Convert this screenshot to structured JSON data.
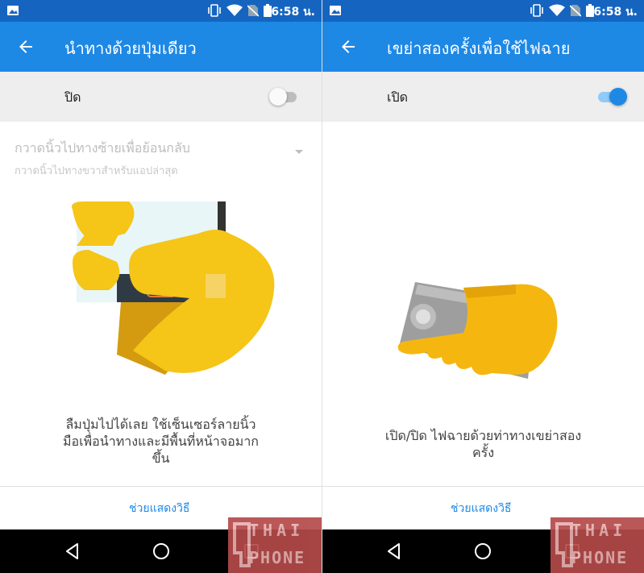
{
  "colors": {
    "status_bar": "#1565c0",
    "app_bar": "#1e88e5",
    "accent": "#1e88e5",
    "toggle_row_bg": "#eeeeee",
    "nav_bar": "#000000",
    "hand_yellow": "#f5c518"
  },
  "status_bar": {
    "time": "16:58 น.",
    "icons": [
      "image-icon",
      "vibrate-icon",
      "wifi-icon",
      "no-sim-icon",
      "battery-icon"
    ]
  },
  "left_screen": {
    "title": "นำทางด้วยปุ่มเดียว",
    "toggle_label": "ปิด",
    "toggle_on": false,
    "dropdown_primary": "กวาดนิ้วไปทางซ้ายเพื่อย้อนกลับ",
    "dropdown_secondary": "กวาดนิ้วไปทางขวาสำหรับแอปล่าสุด",
    "description_lines": [
      "ลืมปุ่มไปได้เลย ใช้เซ็นเซอร์ลายนิ้ว",
      "มือเพื่อนำทางและมีพื้นที่หน้าจอมาก",
      "ขึ้น"
    ],
    "help_link": "ช่วยแสดงวิธี"
  },
  "right_screen": {
    "title": "เขย่าสองครั้งเพื่อใช้ไฟฉาย",
    "toggle_label": "เปิด",
    "toggle_on": true,
    "description_lines": [
      "เปิด/ปิด ไฟฉายด้วยท่าทางเขย่าสอง",
      "ครั้ง"
    ],
    "help_link": "ช่วยแสดงวิธี"
  },
  "nav_bar": {
    "buttons": [
      "back-icon",
      "home-icon",
      "recents-icon"
    ]
  },
  "watermark": {
    "line1": "THAI",
    "line2": "PHONE"
  }
}
